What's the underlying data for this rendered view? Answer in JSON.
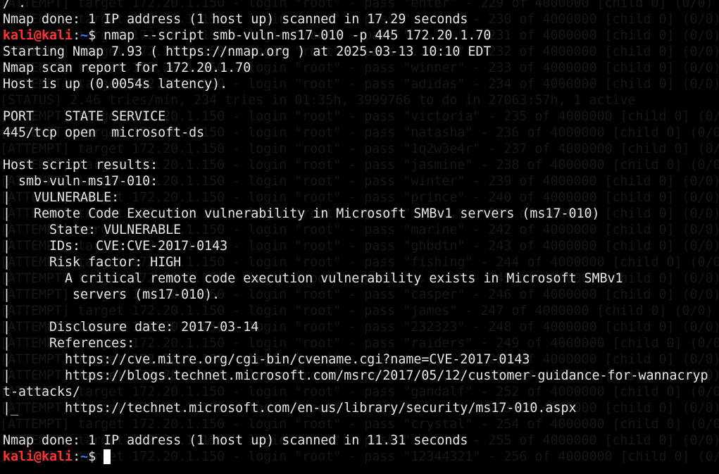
{
  "terminal": {
    "colors": {
      "background": "#000000",
      "foreground": "#e8e8e8",
      "prompt_user": "#ff3333",
      "prompt_path": "#3b78ff",
      "ghost_text": "#161616"
    },
    "prompt": {
      "user_host": "kali@kali",
      "separator": ":",
      "path": "~",
      "symbol": "$"
    },
    "lines": [
      {
        "type": "text",
        "text": "/ ."
      },
      {
        "type": "text",
        "text": "Nmap done: 1 IP address (1 host up) scanned in 17.29 seconds"
      },
      {
        "type": "prompt",
        "command": " nmap --script smb-vuln-ms17-010 -p 445 172.20.1.70"
      },
      {
        "type": "text",
        "text": "Starting Nmap 7.93 ( https://nmap.org ) at 2025-03-13 10:10 EDT"
      },
      {
        "type": "text",
        "text": "Nmap scan report for 172.20.1.70"
      },
      {
        "type": "text",
        "text": "Host is up (0.0054s latency)."
      },
      {
        "type": "text",
        "text": ""
      },
      {
        "type": "text",
        "text": "PORT    STATE SERVICE"
      },
      {
        "type": "text",
        "text": "445/tcp open  microsoft-ds"
      },
      {
        "type": "text",
        "text": ""
      },
      {
        "type": "text",
        "text": "Host script results:"
      },
      {
        "type": "text",
        "text": "| smb-vuln-ms17-010:"
      },
      {
        "type": "text",
        "text": "|   VULNERABLE:"
      },
      {
        "type": "text",
        "text": "|   Remote Code Execution vulnerability in Microsoft SMBv1 servers (ms17-010)"
      },
      {
        "type": "text",
        "text": "|     State: VULNERABLE"
      },
      {
        "type": "text",
        "text": "|     IDs:  CVE:CVE-2017-0143"
      },
      {
        "type": "text",
        "text": "|     Risk factor: HIGH"
      },
      {
        "type": "text",
        "text": "|       A critical remote code execution vulnerability exists in Microsoft SMBv1"
      },
      {
        "type": "text",
        "text": "|        servers (ms17-010)."
      },
      {
        "type": "text",
        "text": "|"
      },
      {
        "type": "text",
        "text": "|     Disclosure date: 2017-03-14"
      },
      {
        "type": "text",
        "text": "|     References:"
      },
      {
        "type": "text",
        "text": "|       https://cve.mitre.org/cgi-bin/cvename.cgi?name=CVE-2017-0143"
      },
      {
        "type": "text",
        "text": "|       https://blogs.technet.microsoft.com/msrc/2017/05/12/customer-guidance-for-wannacryp"
      },
      {
        "type": "text",
        "text": "t-attacks/"
      },
      {
        "type": "text",
        "text": "|_      https://technet.microsoft.com/en-us/library/security/ms17-010.aspx"
      },
      {
        "type": "text",
        "text": ""
      },
      {
        "type": "text",
        "text": "Nmap done: 1 IP address (1 host up) scanned in 11.31 seconds"
      },
      {
        "type": "prompt",
        "command": " ",
        "cursor": true
      }
    ],
    "ghost_lines": [
      "[ATTEMPT] target 172.20.1.150 - login \"root\" - pass \"enter\" - 229 of 4000000 [child 0] (0/0)",
      "[ATTEMPT] target 172.20.1.150 - login \"root\" - pass \"......\" - 230 of 4000000 [child 0] (0/0)",
      "[ATTEMPT] target 172.20.1.150 - login \"root\" - pass \"......\" - 231 of 4000000 [child 0] (0/0)",
      "[ATTEMPT] target 172.20.1.150 - login \"root\" - pass \"......\" - 232 of 4000000 [child 0] (0/0)",
      "[ATTEMPT] target 172.20.1.150 - login \"root\" - pass \"winner\" - 233 of 4000000 [child 0] (0/0)",
      "[ATTEMPT] target 172.20.1.150 - login \"root\" - pass \"adidas\" - 234 of 4000000 [child 0] (0/0)",
      "[STATUS] 2.46 tries/min, 234 tries in 01:35h, 3999766 to do in 27063:57h, 1 active",
      "[ATTEMPT] target 172.20.1.150 - login \"root\" - pass \"victoria\" - 235 of 4000000 [child 0] (0/0)",
      "[ATTEMPT] target 172.20.1.150 - login \"root\" - pass \"natasha\" - 236 of 4000000 [child 0] (0/0)",
      "[ATTEMPT] target 172.20.1.150 - login \"root\" - pass \"1q2w3e4r\" - 237 of 4000000 [child 0] (0/0)",
      "[ATTEMPT] target 172.20.1.150 - login \"root\" - pass \"jasmine\" - 238 of 4000000 [child 0] (0/0)",
      "[ATTEMPT] target 172.20.1.150 - login \"root\" - pass \"winter\" - 239 of 4000000 [child 0] (0/0)",
      "[ATTEMPT] target 172.20.1.150 - login \"root\" - pass \"prince\" - 240 of 4000000 [child 0] (0/0)",
      "[ATTEMPT] target 172.20.1.150 - login \"root\" - pass \"......\" - 241 of 4000000 [child 0] (0/0)",
      "[ATTEMPT] target 172.20.1.150 - login \"root\" - pass \"marine\" - 242 of 4000000 [child 0] (0/0)",
      "[ATTEMPT] target 172.20.1.150 - login \"root\" - pass \"ghbdtn\" - 243 of 4000000 [child 0] (0/0)",
      "[ATTEMPT] target 172.20.1.150 - login \"root\" - pass \"fishing\" - 244 of 4000000 [child 0] (0/0)",
      "[ATTEMPT] target 172.20.1.150 - login \"root\" - pass \"......\" - 245 of 4000000 [child 0] (0/0)",
      "[ATTEMPT] target 172.20.1.150 - login \"root\" - pass \"casper\" - 246 of 4000000 [child 0] (0/0)",
      "[ATTEMPT] target 172.20.1.150 - login \"root\" - pass \"james\" - 247 of 4000000 [child 0] (0/0)",
      "[ATTEMPT] target 172.20.1.150 - login \"root\" - pass \"232323\" - 248 of 4000000 [child 0] (0/0)",
      "[ATTEMPT] target 172.20.1.150 - login \"root\" - pass \"raiders\" - 249 of 4000000 [child 0] (0/0)",
      "[ATTEMPT] target 172.20.1.150 - login \"root\" - pass \"......\" - 250 of 4000000 [child 0] (0/0)",
      "[ATTEMPT] target 172.20.1.150 - login \"root\" - pass \"......\" - 251 of 4000000 [child 0] (0/0)",
      "[ATTEMPT] target 172.20.1.150 - login \"root\" - pass \"gandalf\" - 252 of 4000000 [child 0] (0/0)",
      "[ATTEMPT] target 172.20.1.150 - login \"root\" - pass \"......\" - 253 of 4000000 [child 0] (0/0)",
      "[ATTEMPT] target 172.20.1.150 - login \"root\" - pass \"crystal\" - 254 of 4000000 [child 0] (0/0)",
      "[ATTEMPT] target 172.20.1.150 - login \"root\" - pass \"......\" - 255 of 4000000 [child 0] (0/0)",
      "[ATTEMPT] target 172.20.1.150 - login \"root\" - pass \"12344321\" - 256 of 4000000 [child 0] (0/0)"
    ]
  }
}
